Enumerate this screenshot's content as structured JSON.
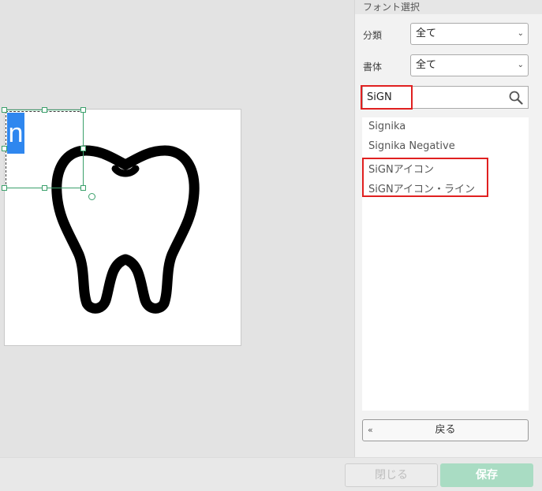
{
  "canvas": {
    "selected_text": "n",
    "icon": "tooth-icon"
  },
  "panel": {
    "title": "フォント選択",
    "category": {
      "label": "分類",
      "value": "全て"
    },
    "typeface": {
      "label": "書体",
      "value": "全て"
    },
    "search": {
      "value": "SiGN",
      "placeholder": "",
      "icon": "search-icon"
    },
    "fonts": [
      "Signika",
      "Signika Negative",
      "SiGNアイコン",
      "SiGNアイコン・ライン"
    ],
    "back_label": "戻る",
    "back_icon": "«"
  },
  "footer": {
    "close_label": "閉じる",
    "save_label": "保存"
  },
  "colors": {
    "accent": "#a9dcc3",
    "highlight": "#e02020",
    "selection": "#2f87ef"
  }
}
